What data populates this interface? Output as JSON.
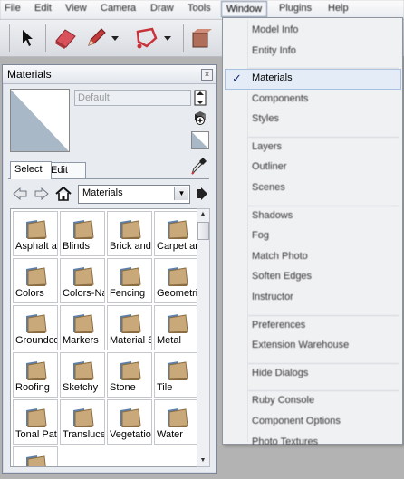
{
  "menubar": {
    "items": [
      "File",
      "Edit",
      "View",
      "Camera",
      "Draw",
      "Tools",
      "Window",
      "Plugins",
      "Help"
    ],
    "open_item": "Window"
  },
  "toolbar": {
    "icons": [
      "select-arrow-icon",
      "eraser-icon",
      "pencil-icon",
      "dropdown-arrow-icon",
      "shape-icon",
      "dropdown-arrow-icon",
      "push-pull-icon"
    ]
  },
  "materials": {
    "title": "Materials",
    "close_glyph": "×",
    "name_placeholder": "Default",
    "tabs": [
      "Select",
      "Edit"
    ],
    "active_tab": "Select",
    "library": "Materials",
    "items": [
      "Asphalt and Concrete",
      "Blinds",
      "Brick and Cladding",
      "Carpet and Textiles",
      "Colors",
      "Colors-Named",
      "Fencing",
      "Geometric Tiles",
      "Groundcover",
      "Markers",
      "Material Shapes",
      "Metal",
      "Roofing",
      "Sketchy",
      "Stone",
      "Tile",
      "Tonal Patterns",
      "Translucent",
      "Vegetation",
      "Water",
      ""
    ],
    "folder_color": "#c9a97a"
  },
  "window_menu": {
    "items": [
      {
        "label": "Model Info",
        "group": 1
      },
      {
        "label": "Entity Info",
        "group": 1
      },
      {
        "label": "Materials",
        "group": 2,
        "checked": true,
        "highlighted": true
      },
      {
        "label": "Components",
        "group": 2
      },
      {
        "label": "Styles",
        "group": 2
      },
      {
        "label": "Layers",
        "group": 3
      },
      {
        "label": "Outliner",
        "group": 3
      },
      {
        "label": "Scenes",
        "group": 3
      },
      {
        "label": "Shadows",
        "group": 4
      },
      {
        "label": "Fog",
        "group": 4
      },
      {
        "label": "Match Photo",
        "group": 4
      },
      {
        "label": "Soften Edges",
        "group": 4
      },
      {
        "label": "Instructor",
        "group": 4
      },
      {
        "label": "Preferences",
        "group": 5
      },
      {
        "label": "Extension Warehouse",
        "group": 5
      },
      {
        "label": "Hide Dialogs",
        "group": 6
      },
      {
        "label": "Ruby Console",
        "group": 7
      },
      {
        "label": "Component Options",
        "group": 7
      },
      {
        "label": "Photo Textures",
        "group": 7
      }
    ],
    "check_glyph": "✓",
    "highlight_color": "#e3ecf7"
  }
}
